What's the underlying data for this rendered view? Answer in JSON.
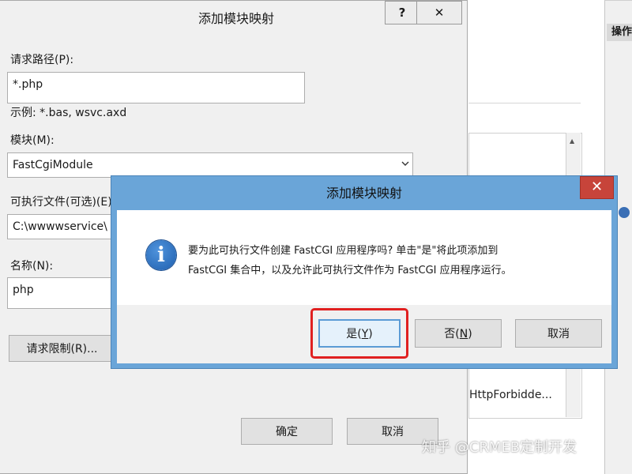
{
  "background": {
    "actions_header": "操作",
    "list_item": "HttpForbidde..."
  },
  "main_dialog": {
    "title": "添加模块映射",
    "help_label": "?",
    "close_label": "✕",
    "path_label": "请求路径(P):",
    "path_value": "*.php",
    "example_text": "示例: *.bas, wsvc.axd",
    "module_label": "模块(M):",
    "module_value": "FastCgiModule",
    "exe_label": "可执行文件(可选)(E):",
    "exe_value": "C:\\wwwwservice\\",
    "name_label": "名称(N):",
    "name_value": "php",
    "request_restrictions_label": "请求限制(R)...",
    "ok_label": "确定",
    "cancel_label": "取消"
  },
  "confirm_dialog": {
    "title": "添加模块映射",
    "close_label": "✕",
    "icon": "info-icon",
    "message_line1": "要为此可执行文件创建 FastCGI 应用程序吗? 单击\"是\"将此项添加到",
    "message_line2": "FastCGI 集合中，以及允许此可执行文件作为 FastCGI 应用程序运行。",
    "yes_label": "是",
    "yes_key": "Y",
    "no_label": "否",
    "no_key": "N",
    "cancel_label": "取消",
    "highlight_color": "#e02020"
  },
  "watermark": "知乎 @CRMEB定制开发"
}
